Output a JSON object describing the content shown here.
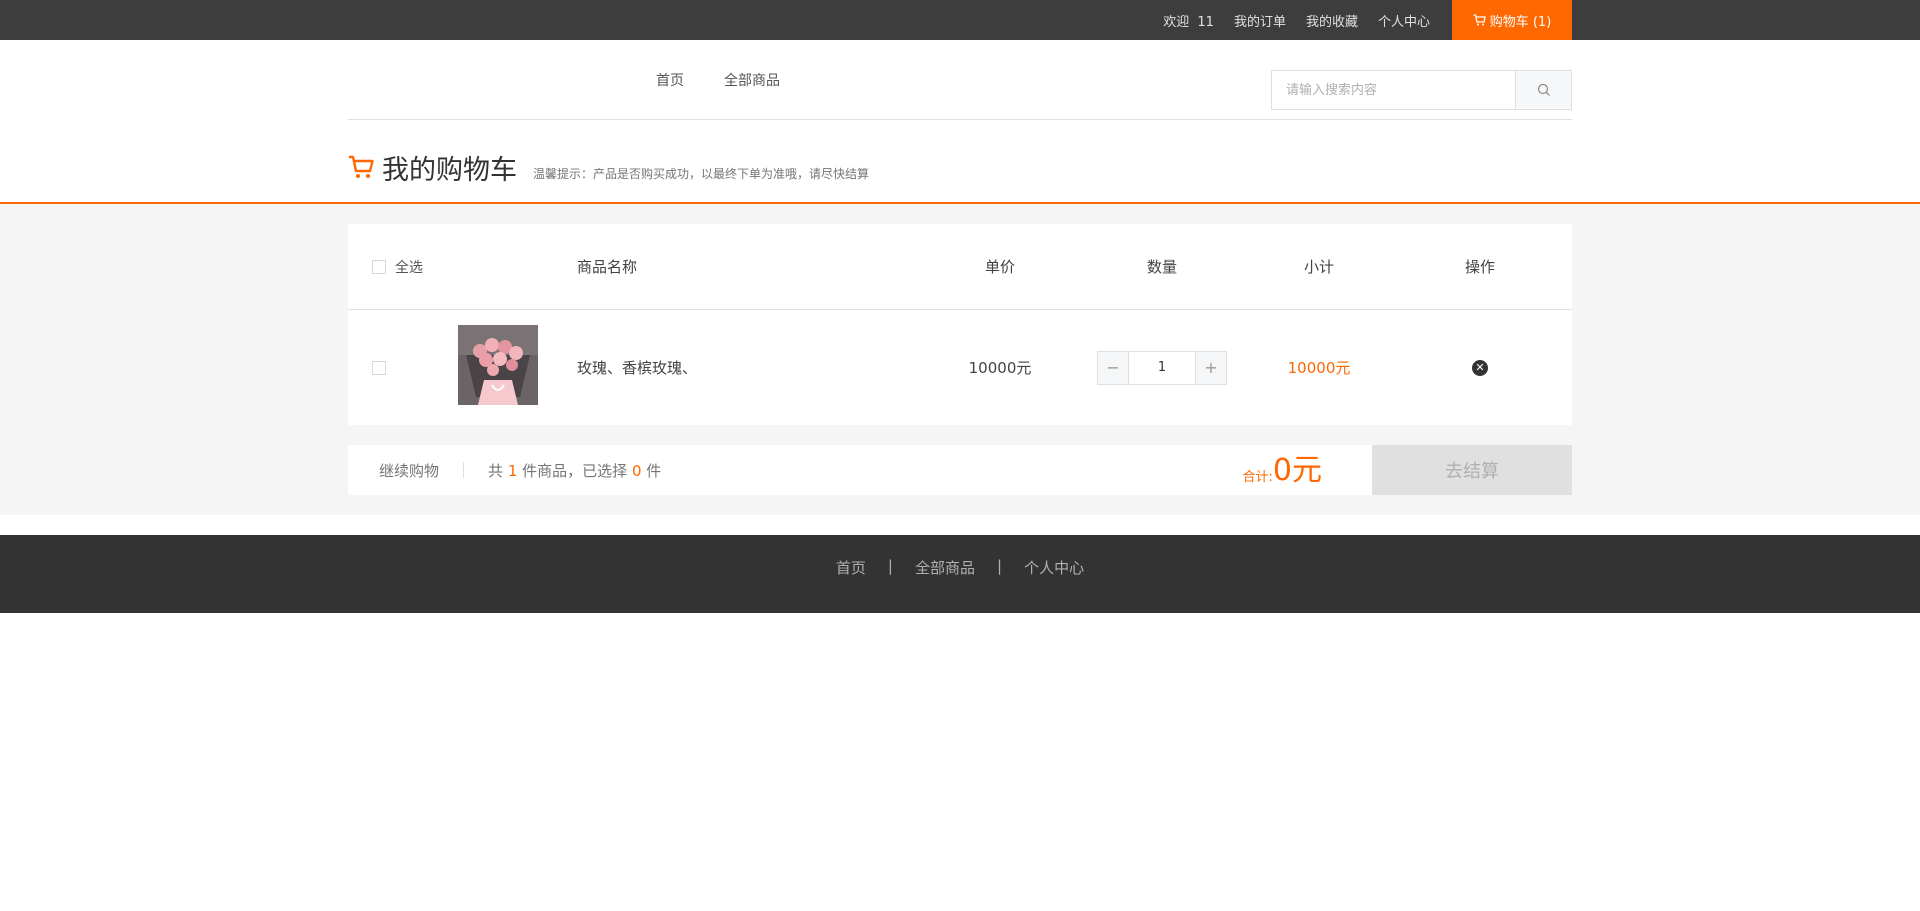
{
  "topbar": {
    "welcome": "欢迎",
    "username": "11",
    "links": [
      "我的订单",
      "我的收藏",
      "个人中心"
    ],
    "cart_label": "购物车 (1)"
  },
  "header": {
    "nav": [
      "首页",
      "全部商品"
    ],
    "search_placeholder": "请输入搜索内容"
  },
  "cart": {
    "title": "我的购物车",
    "tip": "温馨提示：产品是否购买成功，以最终下单为准哦，请尽快结算",
    "columns": {
      "select_all": "全选",
      "name": "商品名称",
      "price": "单价",
      "qty": "数量",
      "subtotal": "小计",
      "op": "操作"
    },
    "items": [
      {
        "name": "玫瑰、香槟玫瑰、",
        "price": "10000元",
        "qty": "1",
        "subtotal": "10000元"
      }
    ]
  },
  "summary": {
    "continue": "继续购物",
    "count_prefix": "共",
    "count_total": "1",
    "count_mid": "件商品，已选择",
    "count_selected": "0",
    "count_suffix": "件",
    "total_label": "合计:",
    "total_value": "0元",
    "checkout": "去结算"
  },
  "footer": {
    "links": [
      "首页",
      "全部商品",
      "个人中心"
    ],
    "separator": "|"
  },
  "colors": {
    "accent": "#ff6700",
    "topbar": "#3d3d3d",
    "footer": "#333333"
  }
}
